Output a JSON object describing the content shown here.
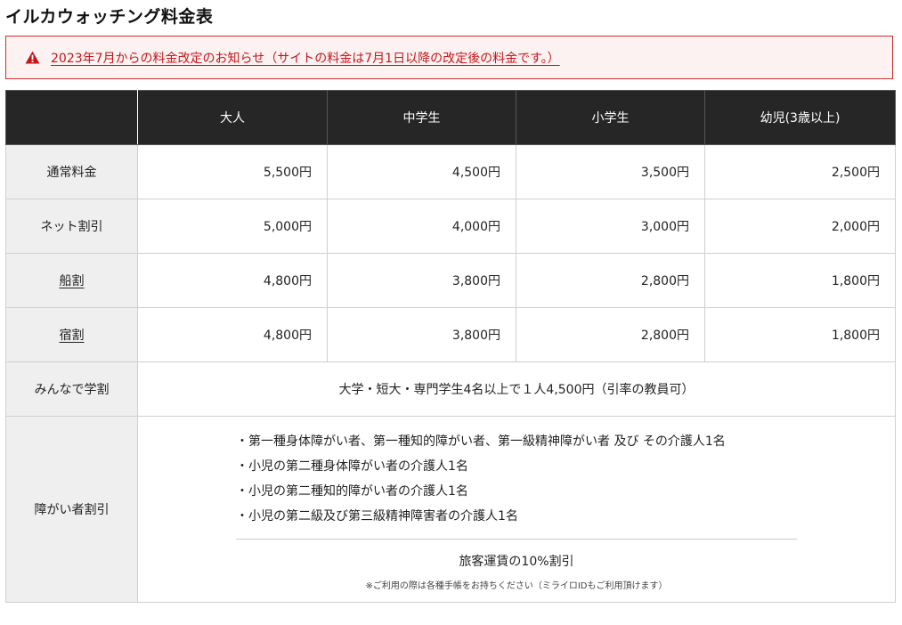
{
  "page": {
    "title": "イルカウォッチング料金表"
  },
  "notice": {
    "icon": "warning-icon",
    "text": "2023年7月からの料金改定のお知らせ（サイトの料金は7月1日以降の改定後の料金です。）",
    "color": "#c4161c"
  },
  "table": {
    "headers": [
      "大人",
      "中学生",
      "小学生",
      "幼児(3歳以上)"
    ],
    "rows": [
      {
        "label": "通常料金",
        "values": [
          "5,500円",
          "4,500円",
          "3,500円",
          "2,500円"
        ]
      },
      {
        "label": "ネット割引",
        "values": [
          "5,000円",
          "4,000円",
          "3,000円",
          "2,000円"
        ]
      },
      {
        "label": "船割",
        "values": [
          "4,800円",
          "3,800円",
          "2,800円",
          "1,800円"
        ]
      },
      {
        "label": "宿割",
        "values": [
          "4,800円",
          "3,800円",
          "2,800円",
          "1,800円"
        ]
      }
    ],
    "group": {
      "label": "みんなで学割",
      "text": "大学・短大・専門学生4名以上で１人4,500円（引率の教員可）"
    },
    "disability": {
      "label": "障がい者割引",
      "items": [
        "・第一種身体障がい者、第一種知的障がい者、第一級精神障がい者 及び その介護人1名",
        "・小児の第二種身体障がい者の介護人1名",
        "・小児の第二種知的障がい者の介護人1名",
        "・小児の第二級及び第三級精神障害者の介護人1名"
      ],
      "rate": "旅客運賃の10%割引",
      "note": "※ご利用の際は各種手帳をお持ちください（ミライロIDもご利用頂けます）"
    }
  }
}
